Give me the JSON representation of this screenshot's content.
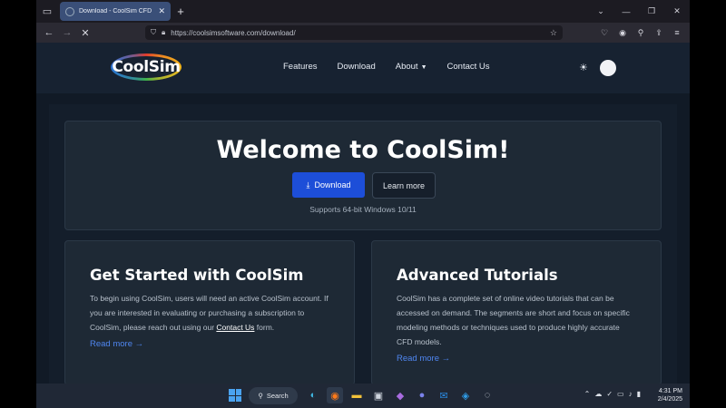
{
  "browser": {
    "tab_title": "Download - CoolSim CFD",
    "url": "https://coolsimsoftware.com/download/"
  },
  "site": {
    "logo_text": "CoolSim",
    "menu": [
      "Features",
      "Download",
      "About",
      "Contact Us"
    ],
    "hero": {
      "title": "Welcome to CoolSim!",
      "download_label": "Download",
      "learn_label": "Learn more",
      "subtitle": "Supports 64-bit Windows 10/11"
    },
    "cards": [
      {
        "title": "Get Started with CoolSim",
        "body_before": "To begin using CoolSim, users will need an active CoolSim account. If you are interested in evaluating or purchasing a subscription to CoolSim, please reach out using our ",
        "link": "Contact Us",
        "body_after": " form.",
        "read_more": "Read more →"
      },
      {
        "title": "Advanced Tutorials",
        "body": "CoolSim has a complete set of online video tutorials that can be accessed on demand. The segments are short and focus on specific modeling methods or techniques used to produce highly accurate CFD models.",
        "read_more": "Read more →"
      }
    ]
  },
  "taskbar": {
    "search_label": "Search",
    "time": "4:31 PM",
    "date": "2/4/2025"
  },
  "colors": {
    "accent": "#1d4ed8",
    "link": "#4f86f0",
    "page_bg": "#111a26",
    "card_bg": "#1e2935"
  }
}
